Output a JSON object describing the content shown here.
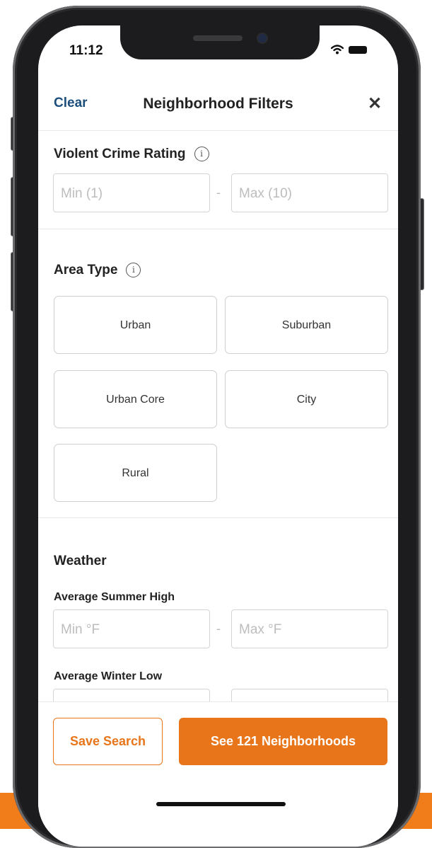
{
  "status_bar": {
    "time": "11:12"
  },
  "header": {
    "clear_label": "Clear",
    "title": "Neighborhood Filters",
    "close_symbol": "✕"
  },
  "crime": {
    "title": "Violent Crime Rating",
    "info_icon": "i",
    "min_placeholder": "Min (1)",
    "max_placeholder": "Max (10)",
    "separator": "-"
  },
  "area_type": {
    "title": "Area Type",
    "info_icon": "i",
    "options": [
      "Urban",
      "Suburban",
      "Urban Core",
      "City",
      "Rural"
    ]
  },
  "weather": {
    "title": "Weather",
    "summer_label": "Average Summer High",
    "summer_min_placeholder": "Min °F",
    "summer_max_placeholder": "Max °F",
    "winter_label": "Average Winter Low",
    "separator": "-"
  },
  "footer": {
    "save_label": "Save Search",
    "see_label": "See 121 Neighborhoods"
  },
  "colors": {
    "accent": "#e8751a",
    "link": "#1c4f7c",
    "bottom_bar": "#f07d1a"
  }
}
